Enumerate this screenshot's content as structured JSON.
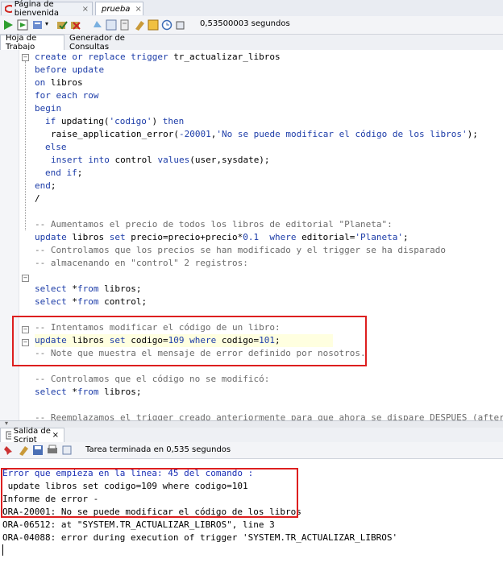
{
  "tabs": [
    {
      "label": "Página de bienvenida",
      "icon": "oracle-icon",
      "active": false
    },
    {
      "label": "prueba",
      "icon": "db-sheet-icon",
      "active": true
    }
  ],
  "toolbar": {
    "elapsed": "0,53500003 segundos"
  },
  "subtabs": [
    "Hoja de Trabajo",
    "Generador de Consultas"
  ],
  "code": {
    "l1": {
      "a": "create or replace trigger ",
      "b": "tr_actualizar_libros"
    },
    "l2": "before update",
    "l3": {
      "a": "on ",
      "b": "libros"
    },
    "l4": "for each row",
    "l5": "begin",
    "l6": {
      "a": "if ",
      "b": "updating(",
      "c": "'codigo'",
      "d": ") ",
      "e": "then"
    },
    "l7": {
      "a": "raise_application_error(",
      "b": "-20001",
      ",": ",",
      "c": "'No se puede modificar el código de los libros'",
      "d": ");"
    },
    "l8": "else",
    "l9": {
      "a": "insert into ",
      "b": "control ",
      "c": "values",
      "d": "(user,sysdate);"
    },
    "l10": {
      "a": "end if",
      "b": ";"
    },
    "l11": {
      "a": "end",
      "b": ";"
    },
    "l12": "/",
    "l13": "-- Aumentamos el precio de todos los libros de editorial \"Planeta\":",
    "l14": {
      "a": "update ",
      "b": "libros ",
      "c": "set ",
      "d": "precio=precio+precio*",
      "e": "0.1",
      "f": "  ",
      "g": "where ",
      "h": "editorial=",
      "i": "'Planeta'",
      "j": ";"
    },
    "l15": "-- Controlamos que los precios se han modificado y el trigger se ha disparado",
    "l16": "-- almacenando en \"control\" 2 registros:",
    "l17": {
      "a": "select ",
      "b": "*",
      "c": "from ",
      "d": "libros;"
    },
    "l18": {
      "a": "select ",
      "b": "*",
      "c": "from ",
      "d": "control;"
    },
    "l19": "-- Intentamos modificar el código de un libro:",
    "l20": {
      "a": "update ",
      "b": "libros ",
      "c": "set ",
      "d": "codigo=",
      "e": "109",
      "f": " where ",
      "g": "codigo=",
      "h": "101",
      "i": ";"
    },
    "l21": "-- Note que muestra el mensaje de error definido por nosotros.",
    "l22": "-- Controlamos que el código no se modificó:",
    "l23": {
      "a": "select ",
      "b": "*",
      "c": "from ",
      "d": "libros;"
    },
    "l24": "-- Reemplazamos el trigger creado anteriormente para que ahora se dispare DESPUES (after)"
  },
  "output": {
    "tab_label": "Salida de Script",
    "status": "Tarea terminada en 0,535 segundos",
    "lines": [
      "Error que empieza en la línea: 45 del comando :",
      " update libros set codigo=109 where codigo=101",
      "Informe de error -",
      "ORA-20001: No se puede modificar el código de los libros",
      "ORA-06512: at \"SYSTEM.TR_ACTUALIZAR_LIBROS\", line 3",
      "ORA-04088: error during execution of trigger 'SYSTEM.TR_ACTUALIZAR_LIBROS'"
    ]
  },
  "colors": {
    "keyword": "#1c3ca8",
    "comment": "#6b6b6b",
    "highlight_box": "#dd1f1f",
    "output_blue": "#1a2fb5"
  }
}
